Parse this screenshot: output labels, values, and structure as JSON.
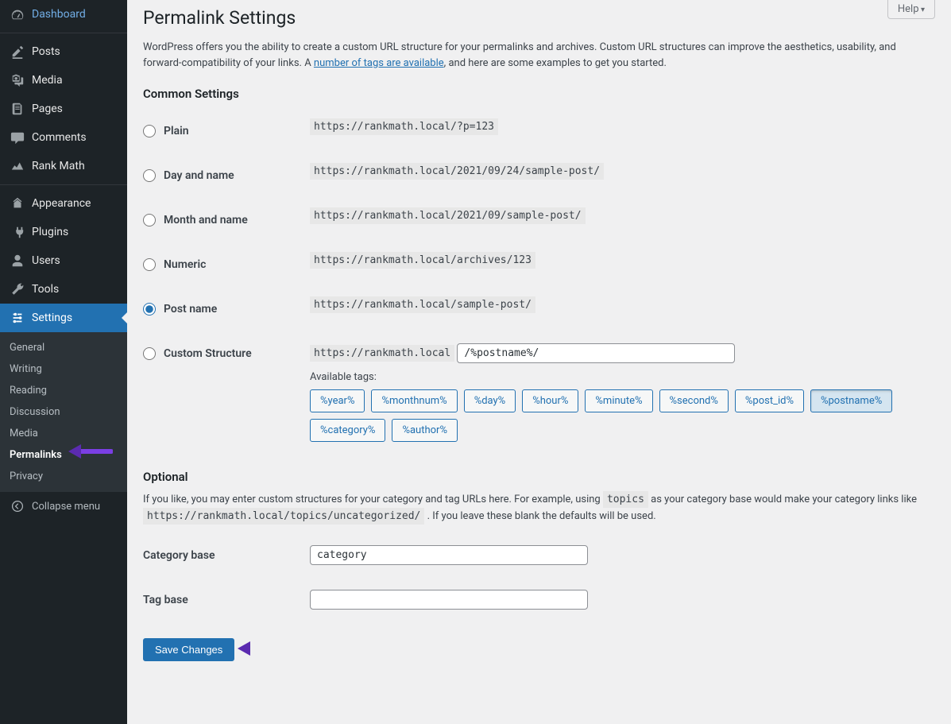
{
  "sidebar": {
    "items": [
      {
        "label": "Dashboard",
        "icon": "dashboard"
      },
      {
        "label": "Posts",
        "icon": "posts"
      },
      {
        "label": "Media",
        "icon": "media"
      },
      {
        "label": "Pages",
        "icon": "pages"
      },
      {
        "label": "Comments",
        "icon": "comments"
      },
      {
        "label": "Rank Math",
        "icon": "rankmath"
      },
      {
        "label": "Appearance",
        "icon": "appearance"
      },
      {
        "label": "Plugins",
        "icon": "plugins"
      },
      {
        "label": "Users",
        "icon": "users"
      },
      {
        "label": "Tools",
        "icon": "tools"
      },
      {
        "label": "Settings",
        "icon": "settings",
        "current": true
      }
    ],
    "submenu": [
      {
        "label": "General"
      },
      {
        "label": "Writing"
      },
      {
        "label": "Reading"
      },
      {
        "label": "Discussion"
      },
      {
        "label": "Media"
      },
      {
        "label": "Permalinks",
        "current": true
      },
      {
        "label": "Privacy"
      }
    ],
    "collapse": "Collapse menu"
  },
  "help_label": "Help",
  "page_title": "Permalink Settings",
  "intro_pre": "WordPress offers you the ability to create a custom URL structure for your permalinks and archives. Custom URL structures can improve the aesthetics, usability, and forward-compatibility of your links. A ",
  "intro_link": "number of tags are available",
  "intro_post": ", and here are some examples to get you started.",
  "common_heading": "Common Settings",
  "options": [
    {
      "label": "Plain",
      "example": "https://rankmath.local/?p=123",
      "checked": false
    },
    {
      "label": "Day and name",
      "example": "https://rankmath.local/2021/09/24/sample-post/",
      "checked": false
    },
    {
      "label": "Month and name",
      "example": "https://rankmath.local/2021/09/sample-post/",
      "checked": false
    },
    {
      "label": "Numeric",
      "example": "https://rankmath.local/archives/123",
      "checked": false
    },
    {
      "label": "Post name",
      "example": "https://rankmath.local/sample-post/",
      "checked": true
    }
  ],
  "custom": {
    "label": "Custom Structure",
    "prefix": "https://rankmath.local",
    "value": "/%postname%/",
    "tags_label": "Available tags:",
    "tags": [
      "%year%",
      "%monthnum%",
      "%day%",
      "%hour%",
      "%minute%",
      "%second%",
      "%post_id%",
      "%postname%",
      "%category%",
      "%author%"
    ],
    "active_tag": "%postname%"
  },
  "optional": {
    "heading": "Optional",
    "desc_pre": "If you like, you may enter custom structures for your category and tag URLs here. For example, using ",
    "desc_code1": "topics",
    "desc_mid": " as your category base would make your category links like ",
    "desc_code2": "https://rankmath.local/topics/uncategorized/",
    "desc_post": " . If you leave these blank the defaults will be used.",
    "cat_label": "Category base",
    "cat_value": "category",
    "tag_label": "Tag base",
    "tag_value": ""
  },
  "save_label": "Save Changes"
}
